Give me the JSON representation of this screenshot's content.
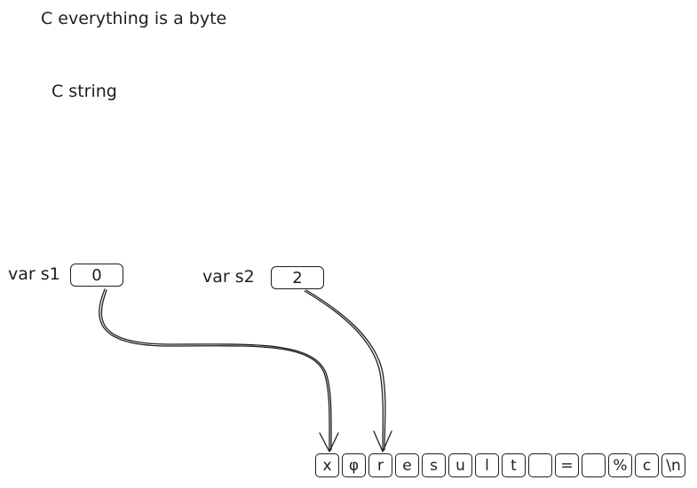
{
  "heading": "C everything is a byte",
  "subheading": "C string",
  "variables": [
    {
      "label": "var s1",
      "value": "0"
    },
    {
      "label": "var s2",
      "value": "2"
    }
  ],
  "byte_cells": [
    "x",
    "φ",
    "r",
    "e",
    "s",
    "u",
    "l",
    "t",
    "",
    "=",
    "",
    "%",
    "c",
    "\\n"
  ],
  "colors": {
    "stroke": "#1e1e1e",
    "background": "#ffffff"
  }
}
